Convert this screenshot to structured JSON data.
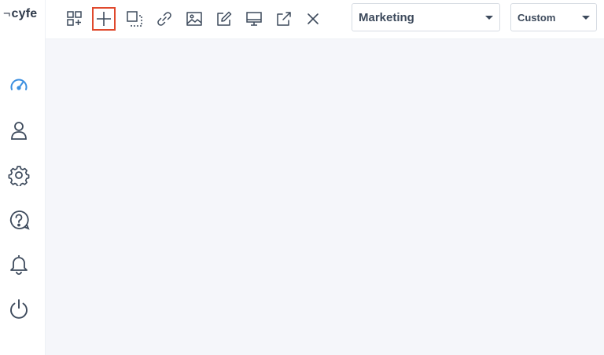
{
  "logo": {
    "mark": "¬",
    "text": "cyfe"
  },
  "sidebar": {
    "items": [
      {
        "name": "dashboards",
        "icon": "speedometer-icon",
        "active": true
      },
      {
        "name": "account",
        "icon": "user-icon"
      },
      {
        "name": "settings",
        "icon": "gear-icon"
      },
      {
        "name": "help",
        "icon": "help-icon"
      },
      {
        "name": "notifications",
        "icon": "bell-icon"
      },
      {
        "name": "logout",
        "icon": "power-icon"
      }
    ]
  },
  "toolbar": {
    "tools": [
      {
        "name": "add-widget",
        "icon": "add-widget-icon"
      },
      {
        "name": "add-dashboard",
        "icon": "plus-icon",
        "highlighted": true
      },
      {
        "name": "clone-dashboard",
        "icon": "copy-icon"
      },
      {
        "name": "share-link",
        "icon": "link-icon"
      },
      {
        "name": "background-image",
        "icon": "image-icon"
      },
      {
        "name": "edit-dashboard",
        "icon": "edit-icon"
      },
      {
        "name": "tv-mode",
        "icon": "monitor-icon"
      },
      {
        "name": "export",
        "icon": "share-icon"
      },
      {
        "name": "delete-dashboard",
        "icon": "close-icon"
      }
    ],
    "dashboard_select": {
      "value": "Marketing"
    },
    "date_range_select": {
      "value": "Custom"
    }
  },
  "colors": {
    "accent": "#3b8fe0",
    "icon": "#3d4a5c",
    "highlight": "#e0492d",
    "canvas": "#f5f6fa"
  }
}
